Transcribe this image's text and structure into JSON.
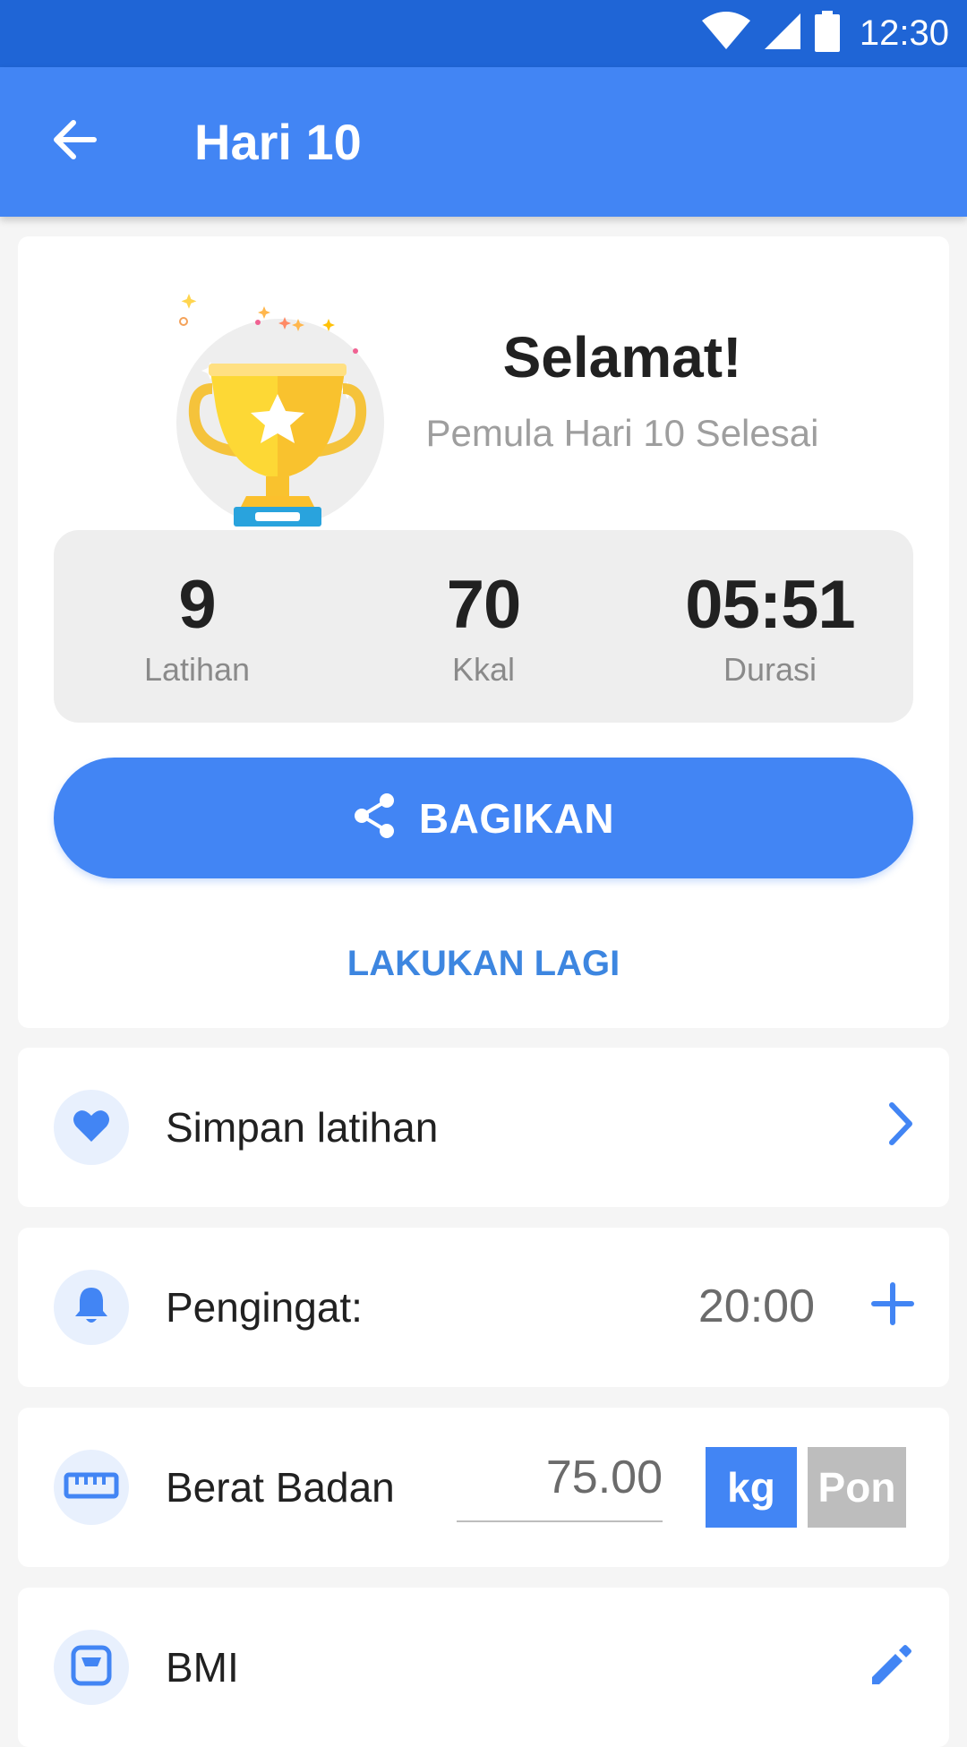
{
  "status_bar": {
    "time": "12:30"
  },
  "app_bar": {
    "title": "Hari 10"
  },
  "summary": {
    "title": "Selamat!",
    "subtitle": "Pemula Hari 10 Selesai",
    "stats": [
      {
        "value": "9",
        "label": "Latihan"
      },
      {
        "value": "70",
        "label": "Kkal"
      },
      {
        "value": "05:51",
        "label": "Durasi"
      }
    ],
    "share_label": "BAGIKAN",
    "again_label": "LAKUKAN LAGI"
  },
  "save_workout": {
    "label": "Simpan latihan"
  },
  "reminder": {
    "label": "Pengingat:",
    "time": "20:00"
  },
  "weight": {
    "label": "Berat Badan",
    "value": "75.00",
    "unit_kg": "kg",
    "unit_lb": "Pon",
    "selected_unit": "kg"
  },
  "bmi": {
    "label": "BMI"
  },
  "colors": {
    "accent": "#4285f4",
    "status_bar": "#1f65d6",
    "link": "#3d86e0"
  }
}
